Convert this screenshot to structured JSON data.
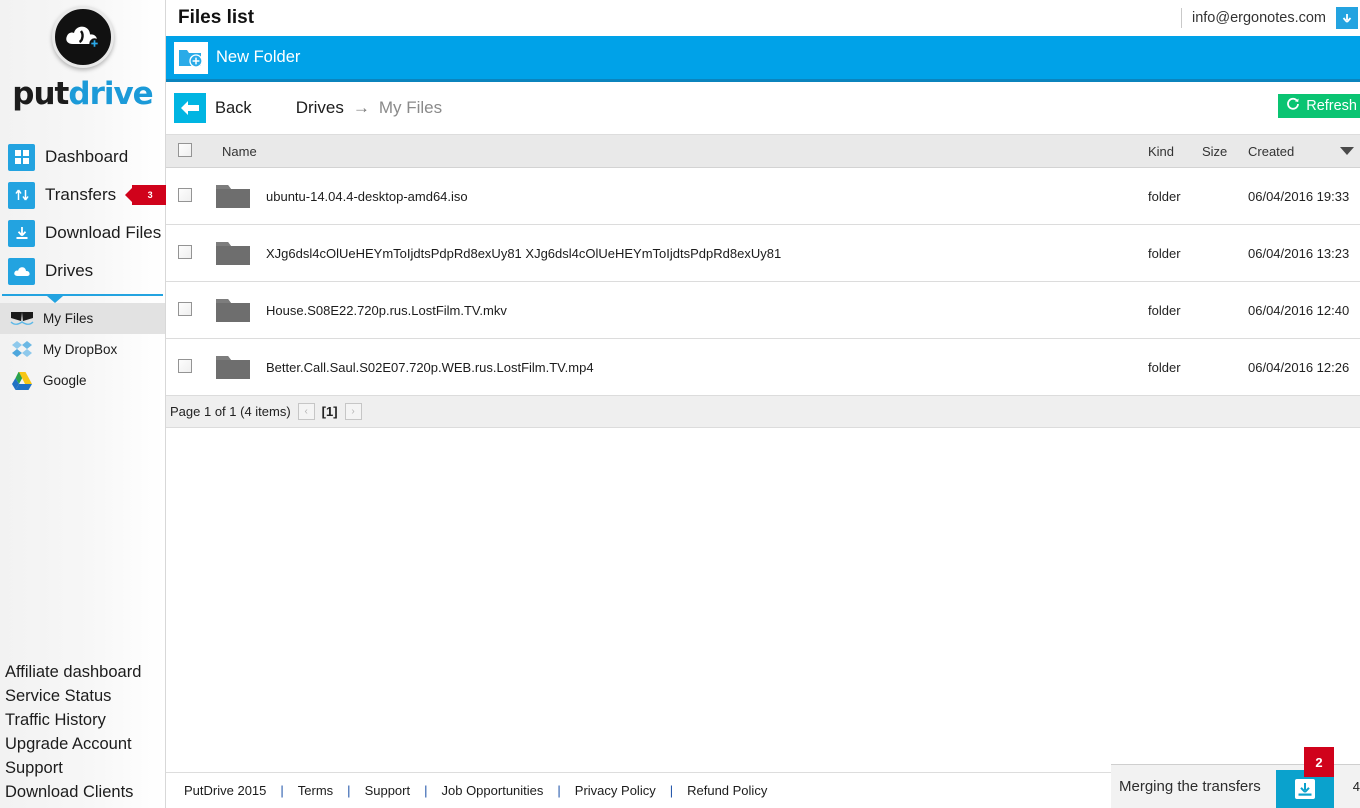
{
  "brand": {
    "part1": "put",
    "part2": "drive",
    "logo_icon": "cloud-logo-icon"
  },
  "sidebar": {
    "nav": [
      {
        "label": "Dashboard",
        "icon": "grid-icon",
        "badge": null
      },
      {
        "label": "Transfers",
        "icon": "transfer-arrows-icon",
        "badge": "3"
      },
      {
        "label": "Download Files",
        "icon": "download-icon",
        "badge": null
      },
      {
        "label": "Drives",
        "icon": "cloud-icon",
        "badge": null
      }
    ],
    "drives": [
      {
        "label": "My Files",
        "icon": "my-files-icon",
        "active": true
      },
      {
        "label": "My DropBox",
        "icon": "dropbox-icon",
        "active": false
      },
      {
        "label": "Google",
        "icon": "google-drive-icon",
        "active": false
      }
    ],
    "footer_links": [
      "Affiliate dashboard",
      "Service Status",
      "Traffic History",
      "Upgrade Account",
      "Support",
      "Download Clients"
    ]
  },
  "header": {
    "title": "Files list",
    "account_email": "info@ergonotes.com",
    "account_icon": "chevron-down-icon"
  },
  "actionbar": {
    "new_folder_label": "New Folder",
    "new_folder_icon": "new-folder-icon"
  },
  "crumbbar": {
    "back_label": "Back",
    "back_icon": "back-arrow-icon",
    "crumb_root": "Drives",
    "crumb_arrow": "→",
    "crumb_current": "My Files",
    "refresh_label": "Refresh",
    "refresh_icon": "refresh-icon"
  },
  "table": {
    "columns": {
      "name": "Name",
      "kind": "Kind",
      "size": "Size",
      "created": "Created"
    },
    "sort_indicator": "sort-descending-icon",
    "rows": [
      {
        "name": "ubuntu-14.04.4-desktop-amd64.iso",
        "kind": "folder",
        "size": "",
        "created": "06/04/2016 19:33",
        "icon": "folder-icon",
        "checked": false
      },
      {
        "name": "XJg6dsl4cOlUeHEYmToIjdtsPdpRd8exUy81 XJg6dsl4cOlUeHEYmToIjdtsPdpRd8exUy81",
        "kind": "folder",
        "size": "",
        "created": "06/04/2016 13:23",
        "icon": "folder-icon",
        "checked": false
      },
      {
        "name": "House.S08E22.720p.rus.LostFilm.TV.mkv",
        "kind": "folder",
        "size": "",
        "created": "06/04/2016 12:40",
        "icon": "folder-icon",
        "checked": false
      },
      {
        "name": "Better.Call.Saul.S02E07.720p.WEB.rus.LostFilm.TV.mp4",
        "kind": "folder",
        "size": "",
        "created": "06/04/2016 12:26",
        "icon": "folder-icon",
        "checked": false
      }
    ]
  },
  "pager": {
    "summary": "Page 1 of 1 (4 items)",
    "prev": "‹",
    "current": "[1]",
    "next": "›"
  },
  "footer": {
    "links": [
      "PutDrive 2015",
      "Terms",
      "Support",
      "Job Opportunities",
      "Privacy Policy",
      "Refund Policy"
    ],
    "separator": "|"
  },
  "download_shelf": {
    "title": "Merging the transfers",
    "badge_count": "2",
    "trailing_count": "4",
    "button_icon": "download-tray-icon"
  },
  "colors": {
    "brand_blue": "#1b9ad8",
    "action_blue": "#00a2e8",
    "icon_blue": "#23a3e0",
    "refresh_green": "#0ac472",
    "badge_red": "#d0021b"
  }
}
